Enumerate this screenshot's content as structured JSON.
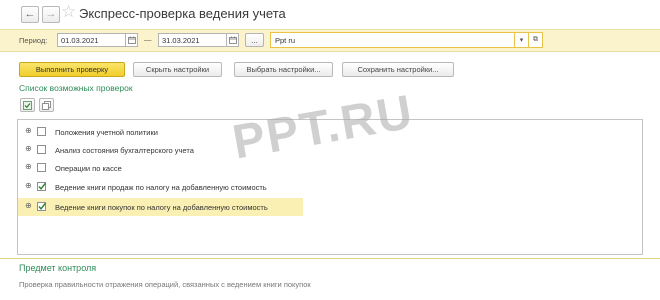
{
  "window": {
    "title": "Экспресс-проверка ведения учета",
    "back_glyph": "←",
    "forward_glyph": "→",
    "favorite_glyph": "☆"
  },
  "period": {
    "label": "Период:",
    "from": "01.03.2021",
    "separator": "—",
    "to": "31.03.2021",
    "select_glyph": "...",
    "org_value": "Ppt ru",
    "dropdown_glyph": "▾",
    "open_glyph": "⧉"
  },
  "toolbar": {
    "run_label": "Выполнить проверку",
    "hide_settings_label": "Скрыть настройки",
    "choose_settings_label": "Выбрать настройки...",
    "save_settings_label": "Сохранить настройки..."
  },
  "checks": {
    "title": "Список возможных проверок",
    "items": [
      {
        "label": "Положения учетной политики",
        "checked": false
      },
      {
        "label": "Анализ состояния бухгалтерского учета",
        "checked": false
      },
      {
        "label": "Операции по кассе",
        "checked": false
      },
      {
        "label": "Ведение книги продаж по налогу на добавленную стоимость",
        "checked": true
      },
      {
        "label": "Ведение книги покупок по налогу на добавленную стоимость",
        "checked": true
      }
    ],
    "expand_glyph": "⊕"
  },
  "subject": {
    "title": "Предмет контроля",
    "text": "Проверка правильности отражения операций, связанных с ведением книги покупок"
  },
  "watermark": "PPT.RU",
  "colors": {
    "accent_green": "#2e8b57",
    "primary_button": "#f3d437",
    "highlight": "#fbf0b3",
    "period_bar": "#faf3cc"
  }
}
